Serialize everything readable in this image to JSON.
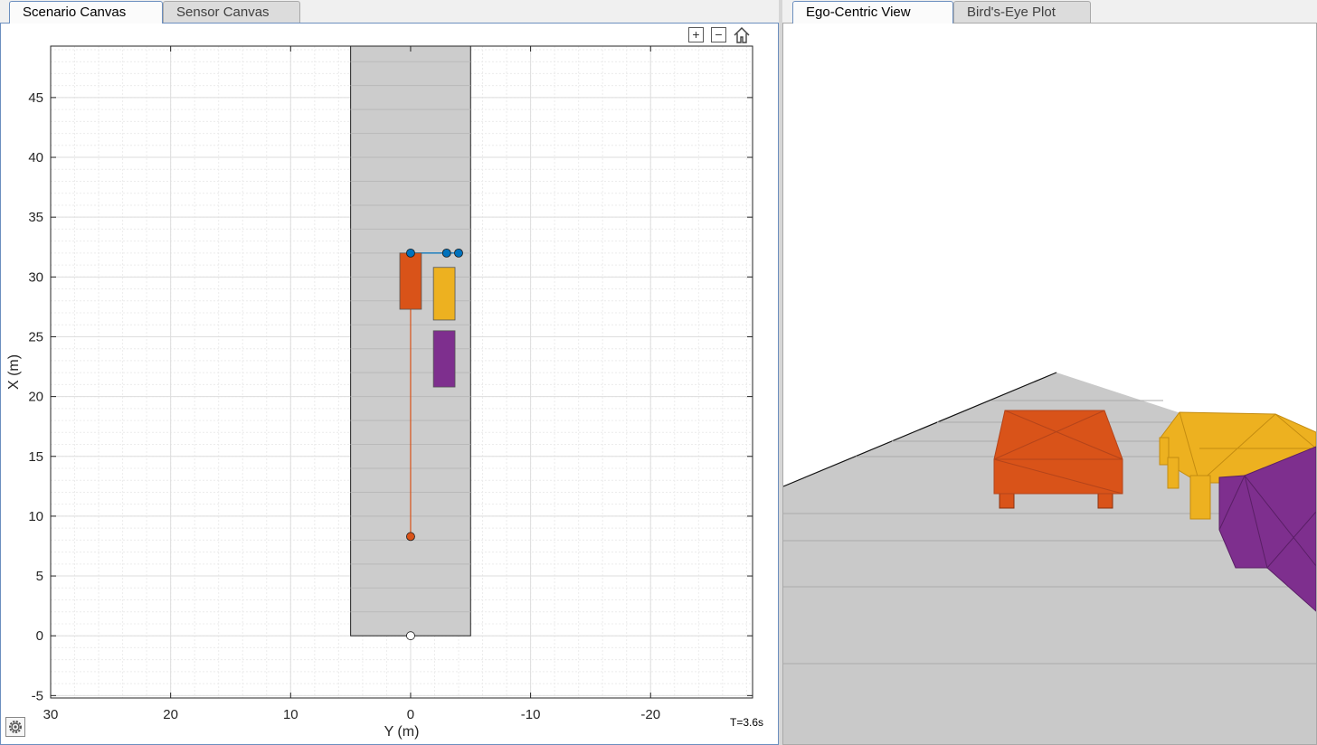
{
  "left_tabs": [
    {
      "label": "Scenario Canvas",
      "active": true
    },
    {
      "label": "Sensor Canvas",
      "active": false
    }
  ],
  "right_tabs": [
    {
      "label": "Ego-Centric View",
      "active": true
    },
    {
      "label": "Bird's-Eye Plot",
      "active": false
    }
  ],
  "toolbar": {
    "zoom_in_icon": "zoom-in-icon",
    "zoom_out_icon": "zoom-out-icon",
    "home_icon": "home-icon"
  },
  "settings_icon": "gear-icon",
  "time_readout": "T=3.6s",
  "colors": {
    "road": "#cccccc",
    "ego_vehicle": "#d95319",
    "vehicle_yellow": "#edb120",
    "vehicle_purple": "#7e2f8e",
    "waypoint_blue": "#0072bd",
    "accent_tab": "#6c8fbf"
  },
  "chart_data": {
    "type": "scatter",
    "title": "",
    "xlabel": "Y (m)",
    "ylabel": "X (m)",
    "xlim": [
      30,
      -28.5
    ],
    "ylim": [
      -5.2,
      49.3
    ],
    "x_ticks": [
      30,
      20,
      10,
      0,
      -10,
      -20
    ],
    "y_ticks": [
      -5,
      0,
      5,
      10,
      15,
      20,
      25,
      30,
      35,
      40,
      45
    ],
    "grid": true,
    "road": {
      "y_left": 5,
      "y_right": -5,
      "x_start": 0,
      "x_end": 49.3
    },
    "vehicles": [
      {
        "name": "ego",
        "color": "#d95319",
        "y_center": 0,
        "x_rear": 27.3,
        "x_front": 32,
        "width": 1.8
      },
      {
        "name": "car-yellow",
        "color": "#edb120",
        "y_center": -2.8,
        "x_rear": 26.4,
        "x_front": 30.8,
        "width": 1.8
      },
      {
        "name": "car-purple",
        "color": "#7e2f8e",
        "y_center": -2.8,
        "x_rear": 20.8,
        "x_front": 25.5,
        "width": 1.8
      }
    ],
    "ego_trajectory": {
      "color": "#d95319",
      "x": [
        8.3,
        32
      ],
      "y": [
        0,
        0
      ]
    },
    "start_waypoint": {
      "x": 8.3,
      "y": 0
    },
    "origin_marker": {
      "x": 0,
      "y": 0
    },
    "blue_waypoints": {
      "x": [
        32,
        32,
        32
      ],
      "y": [
        0,
        -3,
        -4
      ]
    }
  }
}
